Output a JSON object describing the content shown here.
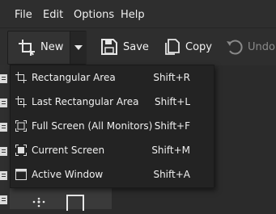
{
  "menubar": {
    "items": [
      {
        "label": "File"
      },
      {
        "label": "Edit"
      },
      {
        "label": "Options"
      },
      {
        "label": "Help"
      }
    ]
  },
  "toolbar": {
    "new_label": "New",
    "save_label": "Save",
    "copy_label": "Copy",
    "undo_label": "Undo"
  },
  "dropdown": {
    "items": [
      {
        "label": "Rectangular Area",
        "shortcut": "Shift+R",
        "icon": "rectangular-area-icon"
      },
      {
        "label": "Last Rectangular Area",
        "shortcut": "Shift+L",
        "icon": "last-rectangular-area-icon"
      },
      {
        "label": "Full Screen (All Monitors)",
        "shortcut": "Shift+F",
        "icon": "full-screen-icon"
      },
      {
        "label": "Current Screen",
        "shortcut": "Shift+M",
        "icon": "current-screen-icon"
      },
      {
        "label": "Active Window",
        "shortcut": "Shift+A",
        "icon": "active-window-icon"
      }
    ]
  },
  "colors": {
    "background": "#2b2b2b",
    "menu_background": "#232323",
    "text": "#f0f0f0",
    "disabled_text": "#8a8a8a"
  }
}
